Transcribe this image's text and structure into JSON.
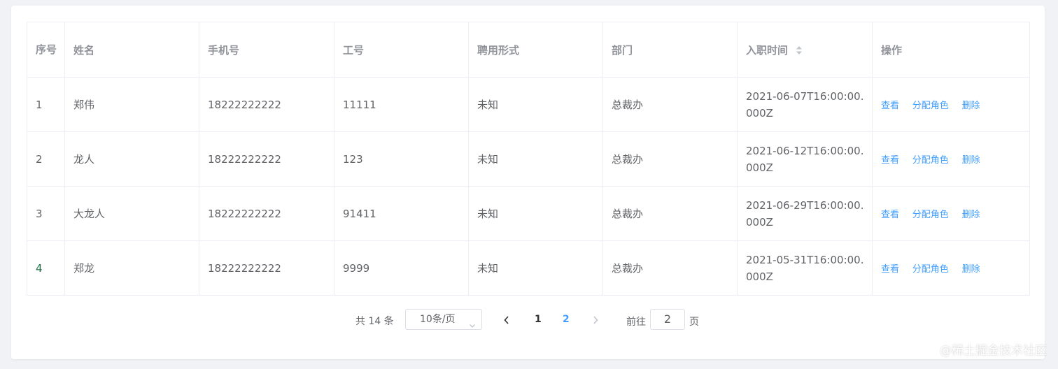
{
  "table": {
    "headers": {
      "seq": "序号",
      "name": "姓名",
      "phone": "手机号",
      "work_id": "工号",
      "hire_form": "聘用形式",
      "dept": "部门",
      "entry_time": "入职时间",
      "actions": "操作"
    },
    "rows": [
      {
        "seq": "1",
        "name": "郑伟",
        "phone": "18222222222",
        "work_id": "11111",
        "hire_form": "未知",
        "dept": "总裁办",
        "entry_time": "2021-06-07T16:00:00.000Z"
      },
      {
        "seq": "2",
        "name": "龙人",
        "phone": "18222222222",
        "work_id": "123",
        "hire_form": "未知",
        "dept": "总裁办",
        "entry_time": "2021-06-12T16:00:00.000Z"
      },
      {
        "seq": "3",
        "name": "大龙人",
        "phone": "18222222222",
        "work_id": "91411",
        "hire_form": "未知",
        "dept": "总裁办",
        "entry_time": "2021-06-29T16:00:00.000Z"
      },
      {
        "seq": "4",
        "name": "郑龙",
        "phone": "18222222222",
        "work_id": "9999",
        "hire_form": "未知",
        "dept": "总裁办",
        "entry_time": "2021-05-31T16:00:00.000Z"
      }
    ],
    "actions": {
      "view": "查看",
      "assign_role": "分配角色",
      "delete": "删除"
    },
    "seq_color_last": "#1f6e43"
  },
  "pagination": {
    "total": "共 14 条",
    "page_size": "10条/页",
    "pages": [
      "1",
      "2"
    ],
    "current_page": "2",
    "goto_label": "前往",
    "goto_value": "2",
    "page_unit": "页"
  },
  "watermark": "@稀土掘金技术社区",
  "colors": {
    "link": "#409eff",
    "header_text": "#909399",
    "border": "#ebeef5",
    "background": "#f0f2f5"
  }
}
